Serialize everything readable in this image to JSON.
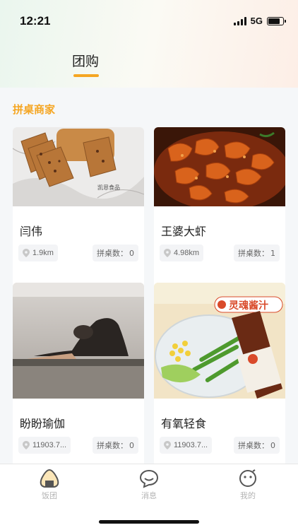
{
  "status": {
    "time": "12:21",
    "network": "5G",
    "battery_level": 0.8
  },
  "header": {
    "tab_label": "团购"
  },
  "section": {
    "title": "拼桌商家"
  },
  "merchants": [
    {
      "name": "闫伟",
      "distance": "1.9km",
      "tables_label": "拼桌数：",
      "tables": "0"
    },
    {
      "name": "王婆大虾",
      "distance": "4.98km",
      "tables_label": "拼桌数：",
      "tables": "1"
    },
    {
      "name": "盼盼瑜伽",
      "distance": "11903.7...",
      "tables_label": "拼桌数：",
      "tables": "0"
    },
    {
      "name": "有氧轻食",
      "distance": "11903.7...",
      "tables_label": "拼桌数：",
      "tables": "0"
    }
  ],
  "photo_text": {
    "bread_watermark": "凯恩食品",
    "salad_banner": "灵魂酱汁"
  },
  "tabbar": {
    "items": [
      {
        "label": "饭团",
        "icon": "rice-ball-icon"
      },
      {
        "label": "消息",
        "icon": "chat-bubble-icon"
      },
      {
        "label": "我的",
        "icon": "profile-icon"
      }
    ]
  },
  "colors": {
    "accent": "#f5a623",
    "background": "#f5f7f9"
  }
}
